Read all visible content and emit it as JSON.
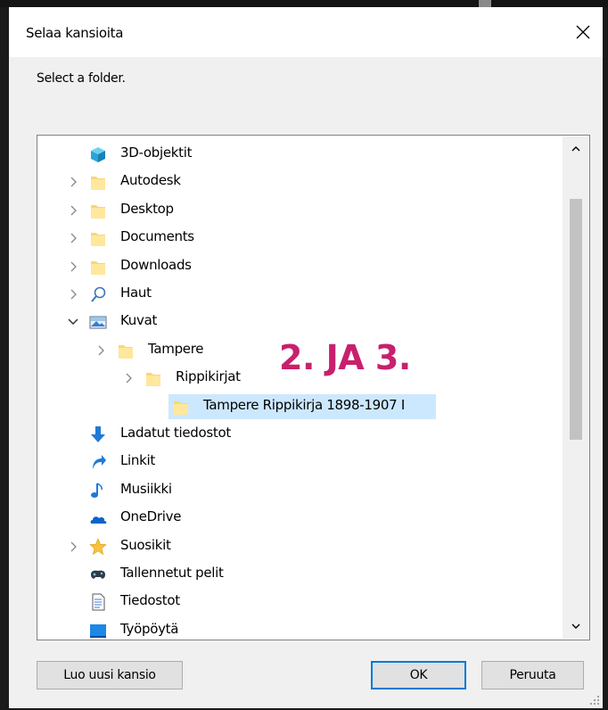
{
  "dialog": {
    "title": "Selaa kansioita",
    "prompt": "Select a folder."
  },
  "tree": {
    "items": [
      {
        "label": "3D-objektit",
        "icon": "3d-objects-icon",
        "expander": "none",
        "level": 0
      },
      {
        "label": "Autodesk",
        "icon": "folder-icon",
        "expander": "collapsed",
        "level": 0
      },
      {
        "label": "Desktop",
        "icon": "folder-icon",
        "expander": "collapsed",
        "level": 0
      },
      {
        "label": "Documents",
        "icon": "folder-icon",
        "expander": "collapsed",
        "level": 0
      },
      {
        "label": "Downloads",
        "icon": "folder-icon",
        "expander": "collapsed",
        "level": 0
      },
      {
        "label": "Haut",
        "icon": "search-icon",
        "expander": "collapsed",
        "level": 0
      },
      {
        "label": "Kuvat",
        "icon": "pictures-icon",
        "expander": "expanded",
        "level": 0
      },
      {
        "label": "Tampere",
        "icon": "folder-icon",
        "expander": "collapsed",
        "level": 1
      },
      {
        "label": "Rippikirjat",
        "icon": "folder-icon",
        "expander": "collapsed",
        "level": 2
      },
      {
        "label": "Tampere Rippikirja 1898-1907 I",
        "icon": "folder-icon",
        "expander": "none",
        "level": 3,
        "selected": true
      },
      {
        "label": "Ladatut tiedostot",
        "icon": "download-arrow-icon",
        "expander": "none",
        "level": 0
      },
      {
        "label": "Linkit",
        "icon": "link-arrow-icon",
        "expander": "none",
        "level": 0
      },
      {
        "label": "Musiikki",
        "icon": "music-note-icon",
        "expander": "none",
        "level": 0
      },
      {
        "label": "OneDrive",
        "icon": "cloud-icon",
        "expander": "none",
        "level": 0
      },
      {
        "label": "Suosikit",
        "icon": "star-icon",
        "expander": "collapsed",
        "level": 0
      },
      {
        "label": "Tallennetut pelit",
        "icon": "saved-games-icon",
        "expander": "none",
        "level": 0
      },
      {
        "label": "Tiedostot",
        "icon": "document-icon",
        "expander": "none",
        "level": 0
      },
      {
        "label": "Työpöytä",
        "icon": "desktop-icon",
        "expander": "none",
        "level": 0
      }
    ]
  },
  "annotation": "2. JA 3.",
  "buttons": {
    "new_folder": "Luo uusi kansio",
    "ok": "OK",
    "cancel": "Peruuta"
  },
  "colors": {
    "selection": "#cce8ff",
    "annotation": "#c8206e",
    "ok_border": "#0078d7",
    "folder": "#f8d775"
  }
}
